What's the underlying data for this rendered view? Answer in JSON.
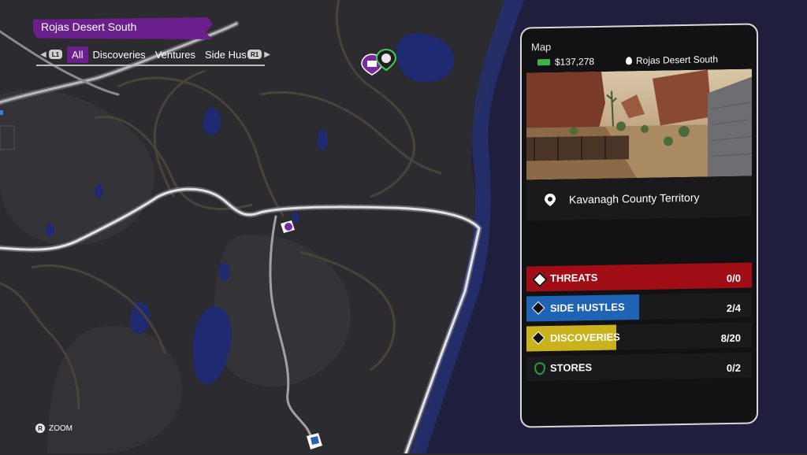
{
  "region": {
    "title": "Rojas Desert South"
  },
  "tabs": {
    "left_button": "L1",
    "right_button": "R1",
    "items": [
      {
        "label": "All",
        "active": true
      },
      {
        "label": "Discoveries",
        "active": false
      },
      {
        "label": "Ventures",
        "active": false
      },
      {
        "label": "Side Hus",
        "active": false
      }
    ]
  },
  "zoom": {
    "button": "R",
    "label": "ZOOM"
  },
  "panel": {
    "title": "Map",
    "money": "$137,278",
    "location": "Rojas Desert South",
    "caption": "Kavanagh County Territory",
    "stats": [
      {
        "label": "THREATS",
        "value": "0/0",
        "color": "#a00d14",
        "fill": 1.0,
        "icon": "threat-icon"
      },
      {
        "label": "SIDE HUSTLES",
        "value": "2/4",
        "color": "#1e63b4",
        "fill": 0.5,
        "icon": "diamond-icon"
      },
      {
        "label": "DISCOVERIES",
        "value": "8/20",
        "color": "#c9b21c",
        "fill": 0.4,
        "icon": "diamond-icon"
      },
      {
        "label": "STORES",
        "value": "0/2",
        "color": "#2e9b3a",
        "fill": 0.0,
        "icon": "shield-icon"
      }
    ]
  },
  "colors": {
    "accent": "#6a1f8c",
    "map_ground": "#2e2e33",
    "water": "#1f2a6b"
  }
}
